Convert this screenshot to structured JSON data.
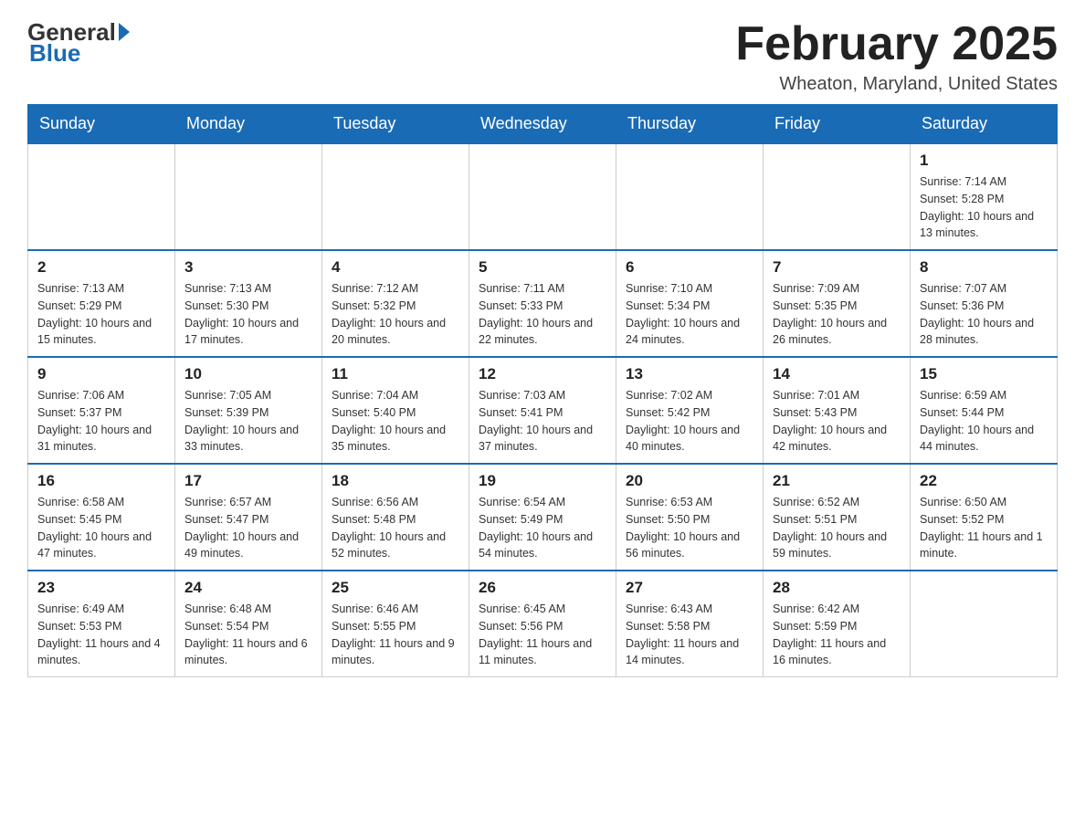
{
  "logo": {
    "general": "General",
    "blue": "Blue"
  },
  "header": {
    "month_year": "February 2025",
    "location": "Wheaton, Maryland, United States"
  },
  "weekdays": [
    "Sunday",
    "Monday",
    "Tuesday",
    "Wednesday",
    "Thursday",
    "Friday",
    "Saturday"
  ],
  "weeks": [
    {
      "days": [
        {
          "number": "",
          "info": "",
          "empty": true
        },
        {
          "number": "",
          "info": "",
          "empty": true
        },
        {
          "number": "",
          "info": "",
          "empty": true
        },
        {
          "number": "",
          "info": "",
          "empty": true
        },
        {
          "number": "",
          "info": "",
          "empty": true
        },
        {
          "number": "",
          "info": "",
          "empty": true
        },
        {
          "number": "1",
          "info": "Sunrise: 7:14 AM\nSunset: 5:28 PM\nDaylight: 10 hours\nand 13 minutes.",
          "empty": false
        }
      ]
    },
    {
      "days": [
        {
          "number": "2",
          "info": "Sunrise: 7:13 AM\nSunset: 5:29 PM\nDaylight: 10 hours\nand 15 minutes.",
          "empty": false
        },
        {
          "number": "3",
          "info": "Sunrise: 7:13 AM\nSunset: 5:30 PM\nDaylight: 10 hours\nand 17 minutes.",
          "empty": false
        },
        {
          "number": "4",
          "info": "Sunrise: 7:12 AM\nSunset: 5:32 PM\nDaylight: 10 hours\nand 20 minutes.",
          "empty": false
        },
        {
          "number": "5",
          "info": "Sunrise: 7:11 AM\nSunset: 5:33 PM\nDaylight: 10 hours\nand 22 minutes.",
          "empty": false
        },
        {
          "number": "6",
          "info": "Sunrise: 7:10 AM\nSunset: 5:34 PM\nDaylight: 10 hours\nand 24 minutes.",
          "empty": false
        },
        {
          "number": "7",
          "info": "Sunrise: 7:09 AM\nSunset: 5:35 PM\nDaylight: 10 hours\nand 26 minutes.",
          "empty": false
        },
        {
          "number": "8",
          "info": "Sunrise: 7:07 AM\nSunset: 5:36 PM\nDaylight: 10 hours\nand 28 minutes.",
          "empty": false
        }
      ]
    },
    {
      "days": [
        {
          "number": "9",
          "info": "Sunrise: 7:06 AM\nSunset: 5:37 PM\nDaylight: 10 hours\nand 31 minutes.",
          "empty": false
        },
        {
          "number": "10",
          "info": "Sunrise: 7:05 AM\nSunset: 5:39 PM\nDaylight: 10 hours\nand 33 minutes.",
          "empty": false
        },
        {
          "number": "11",
          "info": "Sunrise: 7:04 AM\nSunset: 5:40 PM\nDaylight: 10 hours\nand 35 minutes.",
          "empty": false
        },
        {
          "number": "12",
          "info": "Sunrise: 7:03 AM\nSunset: 5:41 PM\nDaylight: 10 hours\nand 37 minutes.",
          "empty": false
        },
        {
          "number": "13",
          "info": "Sunrise: 7:02 AM\nSunset: 5:42 PM\nDaylight: 10 hours\nand 40 minutes.",
          "empty": false
        },
        {
          "number": "14",
          "info": "Sunrise: 7:01 AM\nSunset: 5:43 PM\nDaylight: 10 hours\nand 42 minutes.",
          "empty": false
        },
        {
          "number": "15",
          "info": "Sunrise: 6:59 AM\nSunset: 5:44 PM\nDaylight: 10 hours\nand 44 minutes.",
          "empty": false
        }
      ]
    },
    {
      "days": [
        {
          "number": "16",
          "info": "Sunrise: 6:58 AM\nSunset: 5:45 PM\nDaylight: 10 hours\nand 47 minutes.",
          "empty": false
        },
        {
          "number": "17",
          "info": "Sunrise: 6:57 AM\nSunset: 5:47 PM\nDaylight: 10 hours\nand 49 minutes.",
          "empty": false
        },
        {
          "number": "18",
          "info": "Sunrise: 6:56 AM\nSunset: 5:48 PM\nDaylight: 10 hours\nand 52 minutes.",
          "empty": false
        },
        {
          "number": "19",
          "info": "Sunrise: 6:54 AM\nSunset: 5:49 PM\nDaylight: 10 hours\nand 54 minutes.",
          "empty": false
        },
        {
          "number": "20",
          "info": "Sunrise: 6:53 AM\nSunset: 5:50 PM\nDaylight: 10 hours\nand 56 minutes.",
          "empty": false
        },
        {
          "number": "21",
          "info": "Sunrise: 6:52 AM\nSunset: 5:51 PM\nDaylight: 10 hours\nand 59 minutes.",
          "empty": false
        },
        {
          "number": "22",
          "info": "Sunrise: 6:50 AM\nSunset: 5:52 PM\nDaylight: 11 hours\nand 1 minute.",
          "empty": false
        }
      ]
    },
    {
      "days": [
        {
          "number": "23",
          "info": "Sunrise: 6:49 AM\nSunset: 5:53 PM\nDaylight: 11 hours\nand 4 minutes.",
          "empty": false
        },
        {
          "number": "24",
          "info": "Sunrise: 6:48 AM\nSunset: 5:54 PM\nDaylight: 11 hours\nand 6 minutes.",
          "empty": false
        },
        {
          "number": "25",
          "info": "Sunrise: 6:46 AM\nSunset: 5:55 PM\nDaylight: 11 hours\nand 9 minutes.",
          "empty": false
        },
        {
          "number": "26",
          "info": "Sunrise: 6:45 AM\nSunset: 5:56 PM\nDaylight: 11 hours\nand 11 minutes.",
          "empty": false
        },
        {
          "number": "27",
          "info": "Sunrise: 6:43 AM\nSunset: 5:58 PM\nDaylight: 11 hours\nand 14 minutes.",
          "empty": false
        },
        {
          "number": "28",
          "info": "Sunrise: 6:42 AM\nSunset: 5:59 PM\nDaylight: 11 hours\nand 16 minutes.",
          "empty": false
        },
        {
          "number": "",
          "info": "",
          "empty": true
        }
      ]
    }
  ]
}
